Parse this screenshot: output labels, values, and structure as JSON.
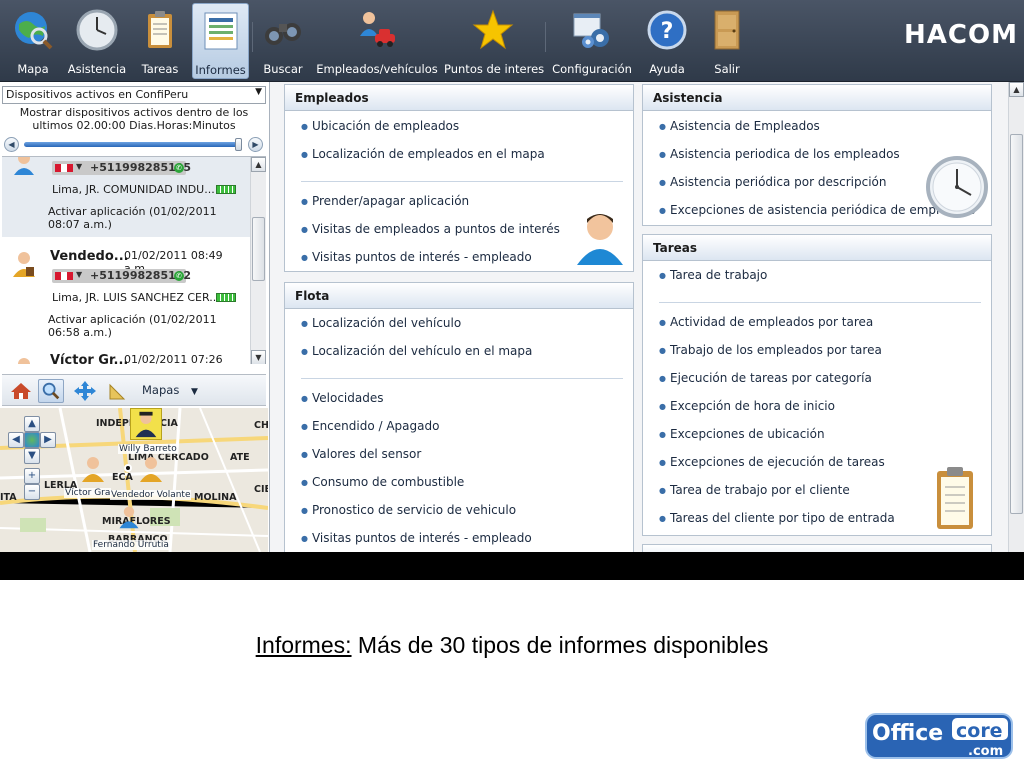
{
  "toolbar": {
    "items": [
      {
        "label": "Mapa",
        "icon": "globe-search-icon"
      },
      {
        "label": "Asistencia",
        "icon": "clock-icon"
      },
      {
        "label": "Tareas",
        "icon": "clipboard-icon"
      },
      {
        "label": "Informes",
        "icon": "report-icon",
        "active": true
      },
      {
        "label": "Buscar",
        "icon": "binoculars-icon"
      },
      {
        "label": "Empleados/vehículos",
        "icon": "person-car-icon"
      },
      {
        "label": "Puntos de interes",
        "icon": "star-icon"
      },
      {
        "label": "Configuración",
        "icon": "gears-icon"
      },
      {
        "label": "Ayuda",
        "icon": "help-icon"
      },
      {
        "label": "Salir",
        "icon": "door-icon"
      }
    ],
    "brand": "HACOM"
  },
  "left_panel": {
    "device_filter": "Dispositivos activos en ConfiPeru",
    "filter_text": "Mostrar dispositivos activos dentro de los ultimos 02.00:00 Dias.Horas:Minutos",
    "devices": [
      {
        "name": "",
        "date": "",
        "phone": "+511998285195",
        "address": "Lima, JR. COMUNIDAD INDU...",
        "activity": "Activar aplicación (01/02/2011 08:07 a.m.)"
      },
      {
        "name": "Vendedo...",
        "date": "01/02/2011 08:49 a.m.",
        "phone": "+511998285192",
        "address": "Lima, JR. LUIS SANCHEZ CER...",
        "activity": "Activar aplicación (01/02/2011 06:58 a.m.)"
      },
      {
        "name": "Víctor Gr...",
        "date": "01/02/2011 07:26 a.m.",
        "phone": "",
        "address": "",
        "activity": ""
      }
    ],
    "map_menu": "Mapas",
    "map": {
      "labels": [
        "INDEPE",
        "CIA",
        "CH",
        "ATE",
        "LIMA CERCADO",
        "ECA",
        "LERLA",
        "MOLINA",
        "CIE",
        "ITA",
        "MIRAFLORES",
        "BARRANCO"
      ],
      "markers": [
        "Willy Barreto",
        "Víctor Gra",
        "Vendedor Volante",
        "Fernando Urrutia"
      ]
    }
  },
  "panels": {
    "empleados": {
      "title": "Empleados",
      "group1": [
        "Ubicación de empleados",
        "Localización de empleados en el mapa"
      ],
      "group2": [
        "Prender/apagar aplicación",
        "Visitas de empleados a puntos de interés",
        "Visitas puntos de interés - empleado"
      ]
    },
    "flota": {
      "title": "Flota",
      "group1": [
        "Localización del vehículo",
        "Localización del vehículo en el mapa"
      ],
      "group2": [
        "Velocidades",
        "Encendido / Apagado",
        "Valores del sensor",
        "Consumo de combustible",
        "Pronostico de servicio de vehiculo",
        "Visitas puntos de interés - empleado"
      ]
    },
    "asistencia": {
      "title": "Asistencia",
      "items": [
        "Asistencia de Empleados",
        "Asistencia periodica de los empleados",
        "Asistencia periódica por descripción",
        "Excepciones de asistencia periódica de empleados"
      ]
    },
    "tareas": {
      "title": "Tareas",
      "group1": [
        "Tarea de trabajo"
      ],
      "group2": [
        "Actividad de empleados por tarea",
        "Trabajo de los empleados por tarea",
        "Ejecución de tareas por categoría",
        "Excepción de hora de inicio",
        "Excepciones de ubicación",
        "Excepciones de ejecución de tareas",
        "Tarea de trabajo por el cliente",
        "Tareas del cliente por tipo de entrada"
      ]
    }
  },
  "caption": {
    "strong": "Informes:",
    "text": " Más de 30 tipos de informes disponibles"
  },
  "logo": {
    "part1": "Office",
    "part2": "core",
    "part3": ".com"
  }
}
